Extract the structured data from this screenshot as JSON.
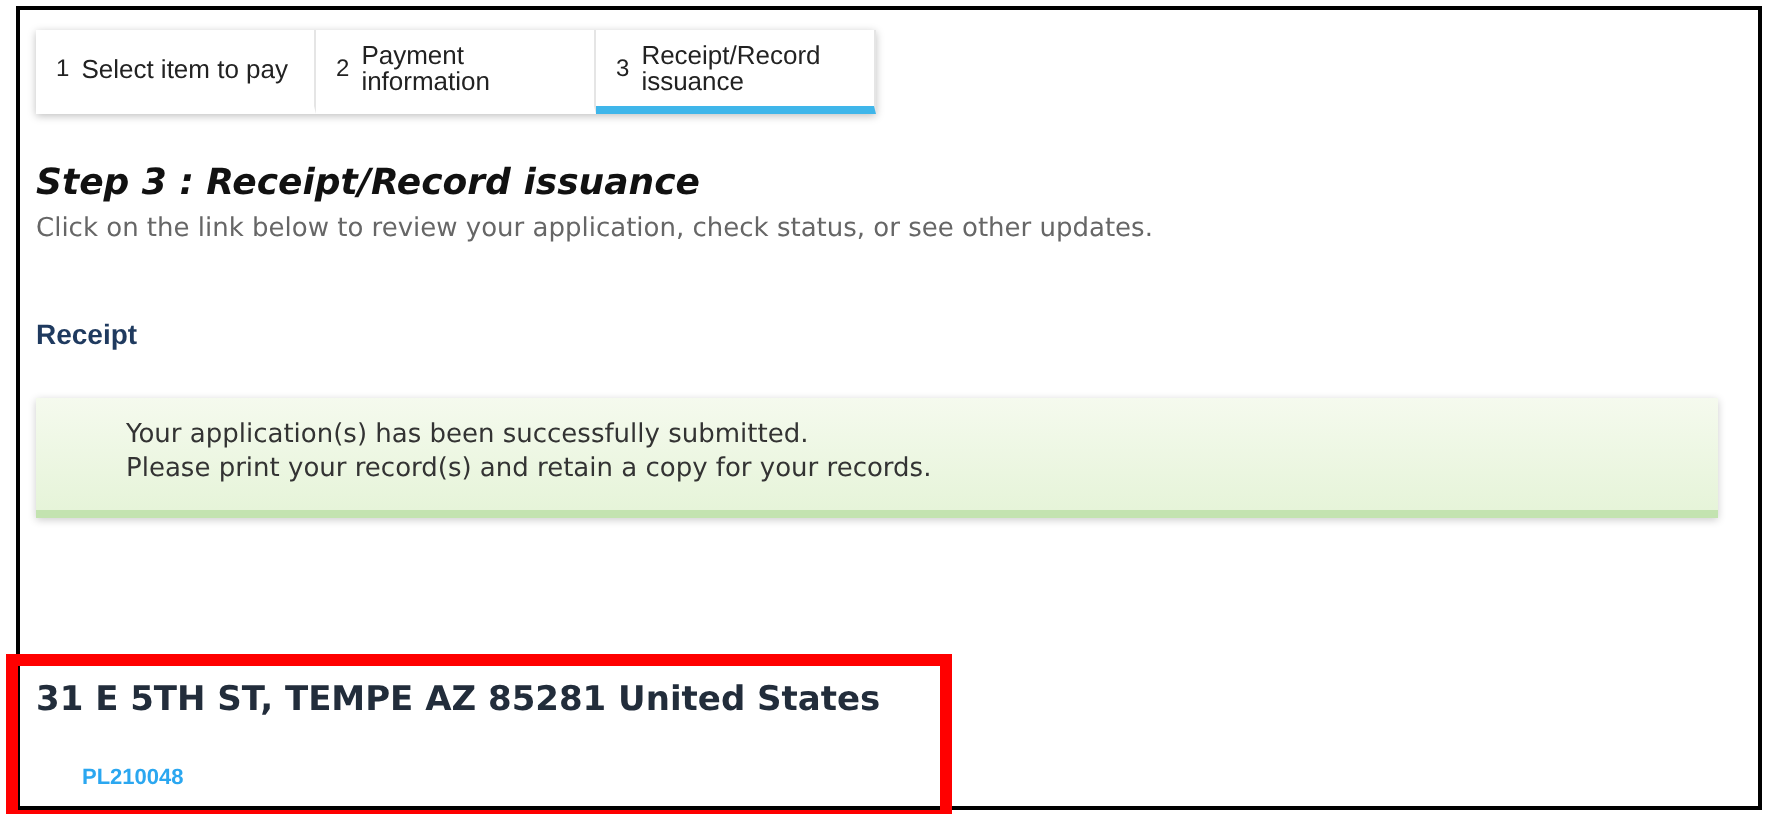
{
  "steps": [
    {
      "number": "1",
      "label": "Select item to pay",
      "selected": false
    },
    {
      "number": "2",
      "label": "Payment information",
      "selected": false
    },
    {
      "number": "3",
      "label": "Receipt/Record issuance",
      "selected": true
    }
  ],
  "heading": "Step 3 : Receipt/Record issuance",
  "instructions": "Click on the link below to review your application, check status, or see other updates.",
  "section_title": "Receipt",
  "success_message": [
    "Your application(s) has been successfully submitted.",
    "Please print your record(s) and retain a copy for your records."
  ],
  "address": "31 E 5TH ST, TEMPE AZ 85281 United States",
  "record_link": "PL210048",
  "highlight": {
    "on": true
  }
}
